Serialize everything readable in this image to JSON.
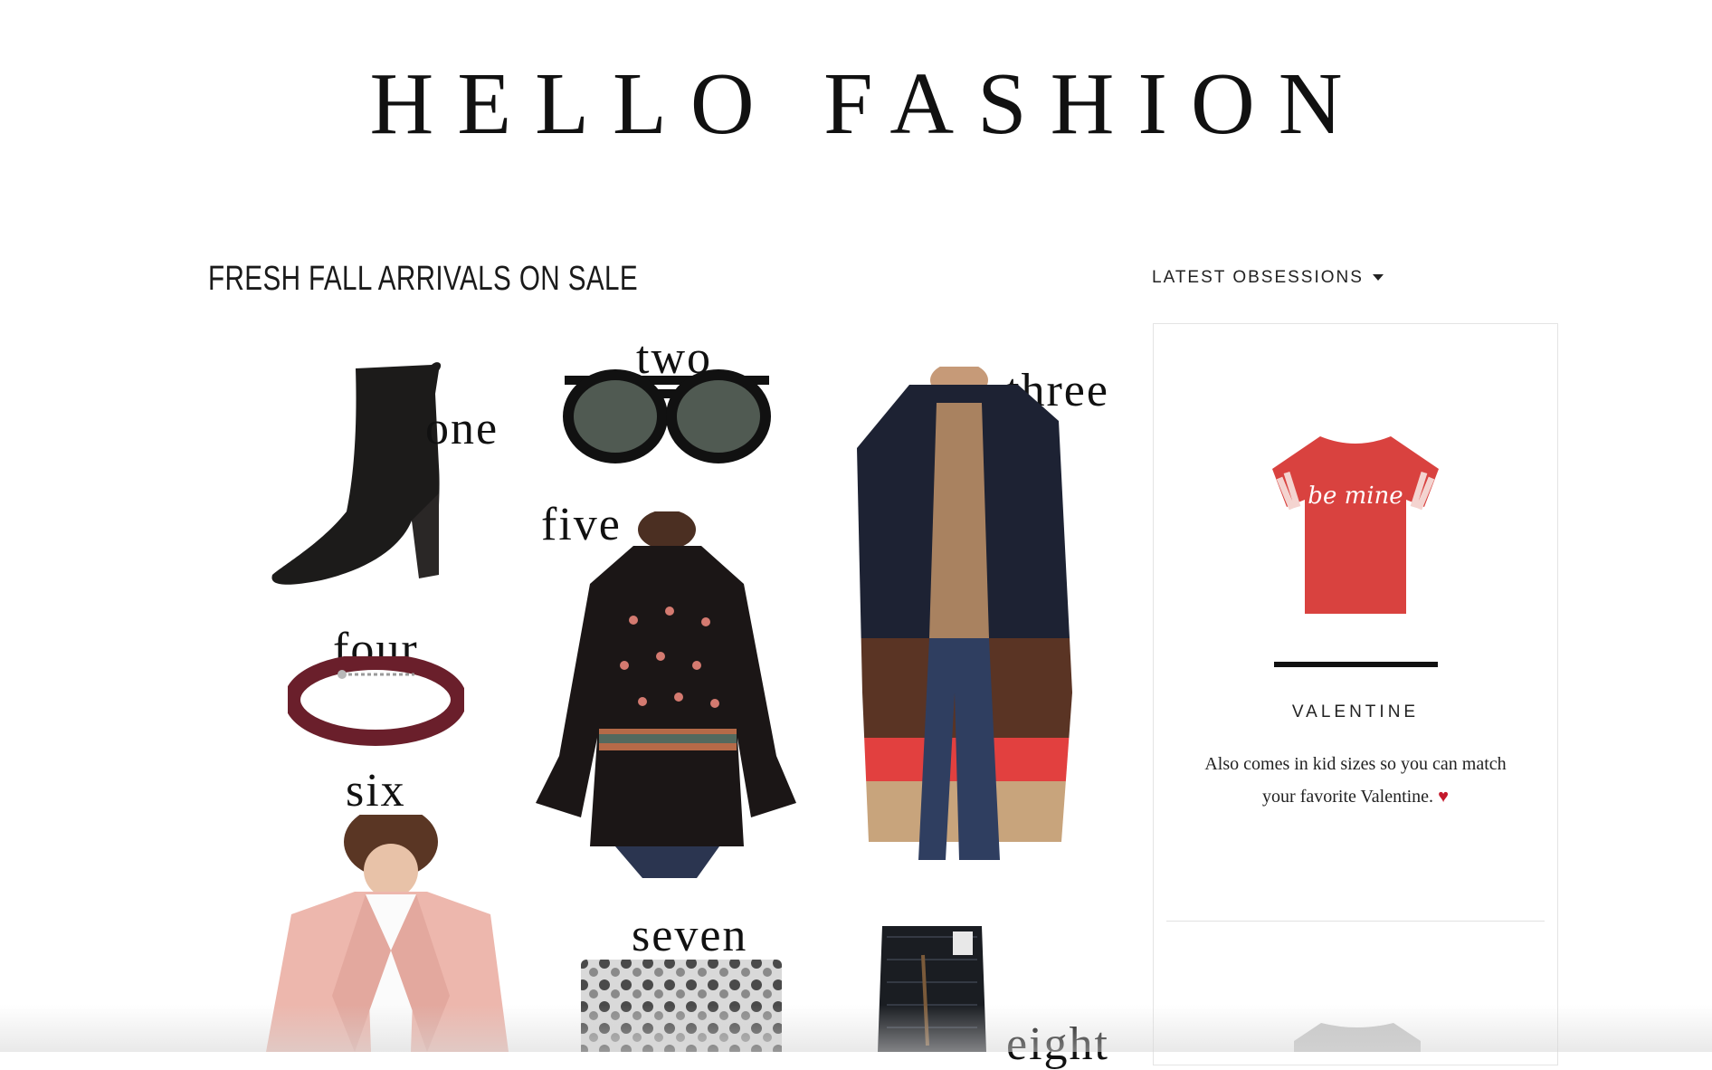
{
  "site": {
    "title": "HELLO FASHION"
  },
  "post": {
    "title": "FRESH FALL ARRIVALS ON SALE",
    "labels": {
      "one": "one",
      "two": "two",
      "three": "three",
      "four": "four",
      "five": "five",
      "six": "six",
      "seven": "seven",
      "eight": "eight"
    }
  },
  "sidebar": {
    "menu_label": "LATEST OBSESSIONS",
    "item": {
      "shirt_text": "be mine",
      "title": "VALENTINE",
      "description": "Also comes in kid sizes so you can match your favorite Valentine.",
      "heart": "♥"
    }
  },
  "colors": {
    "accent_red": "#c4192c",
    "tee_red": "#d9423f",
    "text": "#111111"
  }
}
